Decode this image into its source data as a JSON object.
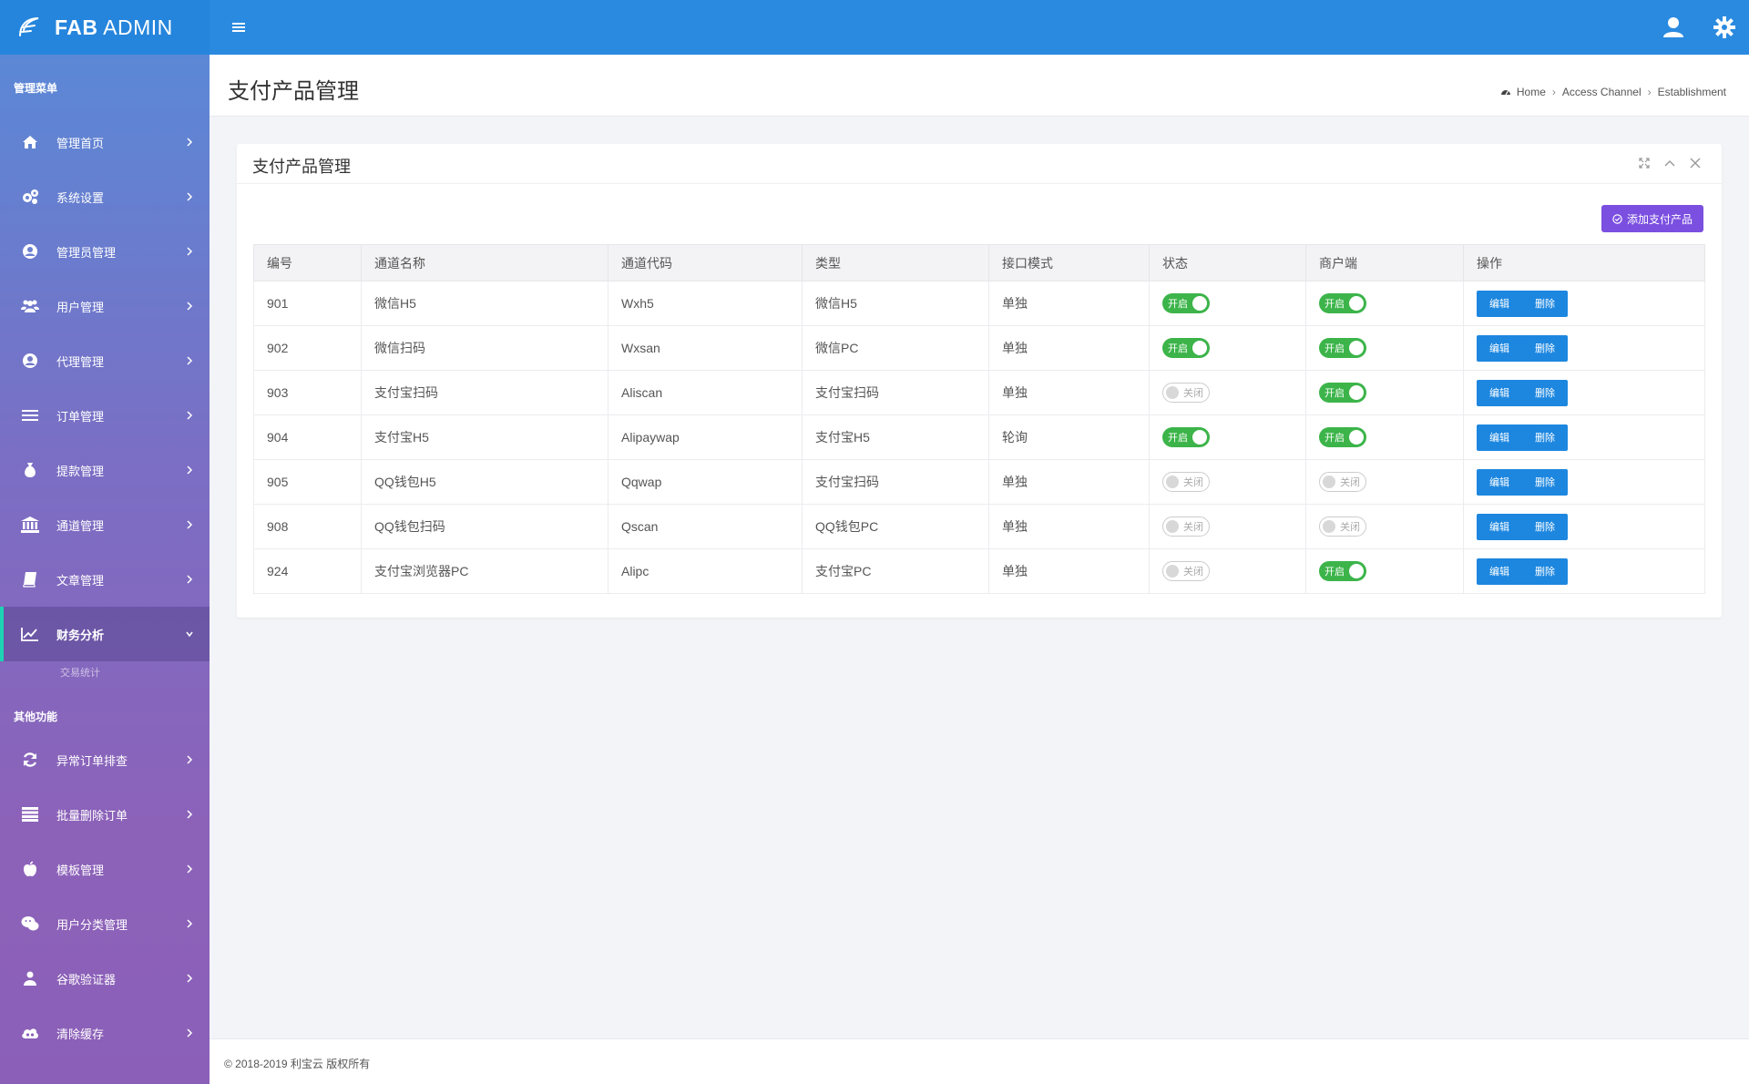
{
  "brand": {
    "name_bold": "FAB",
    "name_rest": " ADMIN"
  },
  "sidebar": {
    "section1": "管理菜单",
    "items": [
      {
        "label": "管理首页",
        "icon": "home-icon"
      },
      {
        "label": "系统设置",
        "icon": "cogs-icon"
      },
      {
        "label": "管理员管理",
        "icon": "user-circle-icon"
      },
      {
        "label": "用户管理",
        "icon": "users-icon"
      },
      {
        "label": "代理管理",
        "icon": "user-circle-icon"
      },
      {
        "label": "订单管理",
        "icon": "list-icon"
      },
      {
        "label": "提款管理",
        "icon": "money-bag-icon"
      },
      {
        "label": "通道管理",
        "icon": "bank-icon"
      },
      {
        "label": "文章管理",
        "icon": "book-icon"
      },
      {
        "label": "财务分析",
        "icon": "line-chart-icon"
      }
    ],
    "sub_partial": "交易统计",
    "section2": "其他功能",
    "items2": [
      {
        "label": "异常订单排查",
        "icon": "refresh-icon"
      },
      {
        "label": "批量删除订单",
        "icon": "list-icon"
      },
      {
        "label": "模板管理",
        "icon": "apple-icon"
      },
      {
        "label": "用户分类管理",
        "icon": "wechat-icon"
      },
      {
        "label": "谷歌验证器",
        "icon": "user-icon"
      },
      {
        "label": "清除缓存",
        "icon": "cloud-icon"
      }
    ]
  },
  "page": {
    "title": "支付产品管理"
  },
  "breadcrumb": {
    "home": "Home",
    "level2": "Access Channel",
    "level3": "Establishment"
  },
  "card": {
    "title": "支付产品管理",
    "add_button": "添加支付产品"
  },
  "table": {
    "headers": [
      "编号",
      "通道名称",
      "通道代码",
      "类型",
      "接口模式",
      "状态",
      "商户端",
      "操作"
    ],
    "rows": [
      {
        "id": "901",
        "name": "微信H5",
        "code": "Wxh5",
        "type": "微信H5",
        "mode": "单独",
        "status": "开启",
        "merchant": "开启"
      },
      {
        "id": "902",
        "name": "微信扫码",
        "code": "Wxsan",
        "type": "微信PC",
        "mode": "单独",
        "status": "开启",
        "merchant": "开启"
      },
      {
        "id": "903",
        "name": "支付宝扫码",
        "code": "Aliscan",
        "type": "支付宝扫码",
        "mode": "单独",
        "status": "关闭",
        "merchant": "开启"
      },
      {
        "id": "904",
        "name": "支付宝H5",
        "code": "Alipaywap",
        "type": "支付宝H5",
        "mode": "轮询",
        "status": "开启",
        "merchant": "开启"
      },
      {
        "id": "905",
        "name": "QQ钱包H5",
        "code": "Qqwap",
        "type": "支付宝扫码",
        "mode": "单独",
        "status": "关闭",
        "merchant": "关闭"
      },
      {
        "id": "908",
        "name": "QQ钱包扫码",
        "code": "Qscan",
        "type": "QQ钱包PC",
        "mode": "单独",
        "status": "关闭",
        "merchant": "关闭"
      },
      {
        "id": "924",
        "name": "支付宝浏览器PC",
        "code": "Alipc",
        "type": "支付宝PC",
        "mode": "单独",
        "status": "关闭",
        "merchant": "开启"
      }
    ],
    "edit_label": "编辑",
    "delete_label": "删除"
  },
  "footer": {
    "copyright": "© 2018-2019 利宝云 版权所有"
  },
  "colors": {
    "topbar": "#2a8ae0",
    "accent": "#7b4fe0",
    "switch_on": "#3cb44a",
    "button": "#1d87e0"
  }
}
